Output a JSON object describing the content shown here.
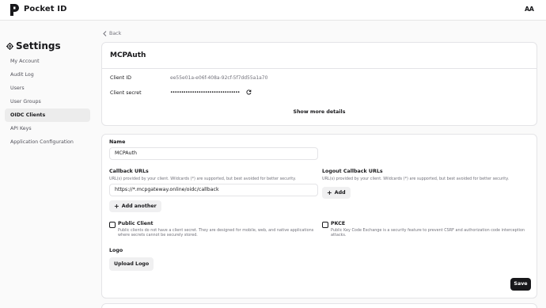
{
  "app": {
    "title": "Pocket ID",
    "avatar_initials": "AA"
  },
  "sidebar": {
    "title": "Settings",
    "items": [
      {
        "label": "My Account"
      },
      {
        "label": "Audit Log"
      },
      {
        "label": "Users"
      },
      {
        "label": "User Groups"
      },
      {
        "label": "OIDC Clients",
        "active": true
      },
      {
        "label": "API Keys"
      },
      {
        "label": "Application Configuration"
      }
    ]
  },
  "back_label": "Back",
  "client": {
    "name": "MCPAuth",
    "client_id_label": "Client ID",
    "client_id": "ee55e01a-e06f-408a-92cf-5f7dd55a1a70",
    "client_secret_label": "Client secret",
    "client_secret": "••••••••••••••••••••••••••••••••",
    "show_more": "Show more details"
  },
  "form": {
    "name_label": "Name",
    "name_value": "MCPAuth",
    "callback_label": "Callback URLs",
    "callback_hint": "URL(s) provided by your client. Wildcards (*) are supported, but best avoided for better security.",
    "callback_value": "https://*.mcpgateway.online/oidc/callback",
    "add_another": "Add another",
    "logout_label": "Logout Callback URLs",
    "logout_hint": "URL(s) provided by your client. Wildcards (*) are supported, but best avoided for better security.",
    "add": "Add",
    "public_label": "Public Client",
    "public_hint": "Public clients do not have a client secret. They are designed for mobile, web, and native applications where secrets cannot be securely stored.",
    "pkce_label": "PKCE",
    "pkce_hint": "Public Key Code Exchange is a security feature to prevent CSRF and authorization code interception attacks.",
    "logo_label": "Logo",
    "upload_logo": "Upload Logo",
    "save": "Save"
  }
}
